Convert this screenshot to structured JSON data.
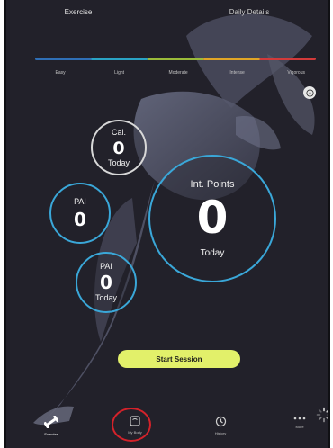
{
  "tabs": {
    "exercise": "Exercise",
    "daily_details": "Daily Details"
  },
  "intensity": {
    "labels": [
      "Easy",
      "Light",
      "Moderate",
      "Intense",
      "Vigorous"
    ],
    "colors": [
      "#2f6fb6",
      "#2aa3c4",
      "#9bbb3a",
      "#e0a526",
      "#d23a3a"
    ]
  },
  "pace_icon": "compass-icon",
  "metrics": {
    "calories": {
      "title": "Cal.",
      "value": "0",
      "sub": "Today"
    },
    "pai_1": {
      "title": "PAI",
      "value": "0"
    },
    "pai_2": {
      "title": "PAI",
      "value": "0",
      "sub": "Today"
    },
    "int_points": {
      "title": "Int. Points",
      "value": "0",
      "sub": "Today"
    }
  },
  "start_button": "Start Session",
  "nav": {
    "exercise": "Exercise",
    "my_body": "My Body",
    "history": "History",
    "more": "More"
  },
  "colors": {
    "background": "#22212a",
    "accent_blue": "#3aa7d8",
    "button_lime": "#e2f06a",
    "highlight_red": "#d4222a"
  }
}
